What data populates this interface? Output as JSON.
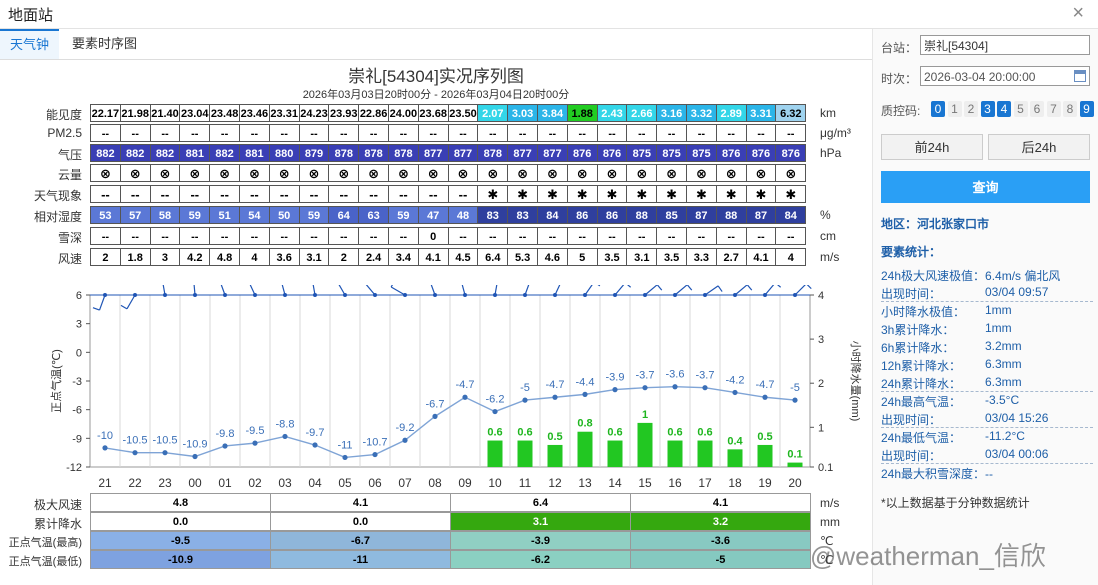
{
  "window": {
    "title": "地面站",
    "close": "×"
  },
  "tabs": [
    {
      "label": "天气钟"
    },
    {
      "label": "要素时序图"
    }
  ],
  "chart": {
    "title": "崇礼[54304]实况序列图",
    "subtitle": "2026年03月03日20时00分 - 2026年03月04日20时00分"
  },
  "table": {
    "rows": [
      {
        "label": "能见度",
        "unit": "km",
        "values": [
          "22.17",
          "21.98",
          "21.40",
          "23.04",
          "23.48",
          "23.46",
          "23.31",
          "24.23",
          "23.93",
          "22.86",
          "24.00",
          "23.68",
          "23.50",
          "2.07",
          "3.03",
          "3.84",
          "1.88",
          "2.43",
          "2.66",
          "3.16",
          "3.32",
          "2.89",
          "3.31",
          "6.32"
        ]
      },
      {
        "label": "PM2.5",
        "unit": "μg/m³",
        "values": [
          "--",
          "--",
          "--",
          "--",
          "--",
          "--",
          "--",
          "--",
          "--",
          "--",
          "--",
          "--",
          "--",
          "--",
          "--",
          "--",
          "--",
          "--",
          "--",
          "--",
          "--",
          "--",
          "--",
          "--"
        ]
      },
      {
        "label": "气压",
        "unit": "hPa",
        "values": [
          "882",
          "882",
          "882",
          "881",
          "882",
          "881",
          "880",
          "879",
          "878",
          "878",
          "878",
          "877",
          "877",
          "878",
          "877",
          "877",
          "876",
          "876",
          "875",
          "875",
          "875",
          "876",
          "876",
          "876"
        ]
      },
      {
        "label": "云量",
        "unit": "",
        "values": [
          "⊗",
          "⊗",
          "⊗",
          "⊗",
          "⊗",
          "⊗",
          "⊗",
          "⊗",
          "⊗",
          "⊗",
          "⊗",
          "⊗",
          "⊗",
          "⊗",
          "⊗",
          "⊗",
          "⊗",
          "⊗",
          "⊗",
          "⊗",
          "⊗",
          "⊗",
          "⊗",
          "⊗"
        ]
      },
      {
        "label": "天气现象",
        "unit": "",
        "values": [
          "--",
          "--",
          "--",
          "--",
          "--",
          "--",
          "--",
          "--",
          "--",
          "--",
          "--",
          "--",
          "--",
          "✱",
          "✱",
          "✱",
          "✱",
          "✱",
          "✱",
          "✱",
          "✱",
          "✱",
          "✱",
          "✱"
        ]
      },
      {
        "label": "相对湿度",
        "unit": "%",
        "values": [
          "53",
          "57",
          "58",
          "59",
          "51",
          "54",
          "50",
          "59",
          "64",
          "63",
          "59",
          "47",
          "48",
          "83",
          "83",
          "84",
          "86",
          "86",
          "88",
          "85",
          "87",
          "88",
          "87",
          "84"
        ]
      },
      {
        "label": "雪深",
        "unit": "cm",
        "values": [
          "--",
          "--",
          "--",
          "--",
          "--",
          "--",
          "--",
          "--",
          "--",
          "--",
          "--",
          "0",
          "--",
          "--",
          "--",
          "--",
          "--",
          "--",
          "--",
          "--",
          "--",
          "--",
          "--",
          "--"
        ]
      },
      {
        "label": "风速",
        "unit": "m/s",
        "values": [
          "2",
          "1.8",
          "3",
          "4.2",
          "4.8",
          "4",
          "3.6",
          "3.1",
          "2",
          "2.4",
          "3.4",
          "4.1",
          "4.5",
          "6.4",
          "5.3",
          "4.6",
          "5",
          "3.5",
          "3.1",
          "3.5",
          "3.3",
          "2.7",
          "4.1",
          "4"
        ]
      }
    ]
  },
  "chart_data": {
    "type": "line",
    "x": [
      "21",
      "22",
      "23",
      "00",
      "01",
      "02",
      "03",
      "04",
      "05",
      "06",
      "07",
      "08",
      "09",
      "10",
      "11",
      "12",
      "13",
      "14",
      "15",
      "16",
      "17",
      "18",
      "19",
      "20"
    ],
    "ylabel": "正点气温(℃)",
    "ylim": [
      -12,
      6
    ],
    "yticks": [
      6,
      3,
      0,
      -3,
      -6,
      -9,
      -12
    ],
    "y2label": "小时降水量(mm)",
    "y2lim": [
      0.1,
      4
    ],
    "y2ticks": [
      4,
      3,
      2,
      1,
      0.1
    ],
    "grid": true,
    "temperature": [
      -10,
      -10.5,
      -10.5,
      -10.9,
      -9.8,
      -9.5,
      -8.8,
      -9.7,
      -11,
      -10.7,
      -9.2,
      -6.7,
      -4.7,
      -6.2,
      -5,
      -4.7,
      -4.4,
      -3.9,
      -3.7,
      -3.6,
      -3.7,
      -4.2,
      -4.7,
      -5
    ],
    "temperature_labels": [
      "-10",
      "-10.5",
      "-10.5",
      "-10.9",
      "-9.8",
      "-9.5",
      "-8.8",
      "-9.7",
      "-11",
      "-10.7",
      "-9.2",
      "-6.7",
      "-4.7",
      "-6.2",
      "-5",
      "-4.7",
      "-4.4",
      "-3.9",
      "-3.7",
      "-3.6",
      "-3.7",
      "-4.2",
      "-4.7",
      "-5"
    ],
    "precipitation": [
      0,
      0,
      0,
      0,
      0,
      0,
      0,
      0,
      0,
      0,
      0,
      0,
      0,
      0.6,
      0.6,
      0.5,
      0.8,
      0.6,
      1,
      0.6,
      0.6,
      0.4,
      0.5,
      0.1
    ],
    "precipitation_labels": [
      "",
      "",
      "",
      "",
      "",
      "",
      "",
      "",
      "",
      "",
      "",
      "",
      "",
      "0.6",
      "0.6",
      "0.5",
      "0.8",
      "0.6",
      "1",
      "0.6",
      "0.6",
      "0.4",
      "0.5",
      "0.1"
    ],
    "colors": {
      "temperature": "#3a6fb7",
      "precipitation": "#22c722",
      "wind": "#1f55b5"
    }
  },
  "summary": {
    "rows": [
      {
        "label": "极大风速",
        "unit": "m/s",
        "values": [
          "4.8",
          "4.1",
          "6.4",
          "4.1"
        ]
      },
      {
        "label": "累计降水",
        "unit": "mm",
        "values": [
          "0.0",
          "0.0",
          "3.1",
          "3.2"
        ]
      },
      {
        "label": "正点气温(最高)",
        "unit": "℃",
        "values": [
          "-9.5",
          "-6.7",
          "-3.9",
          "-3.6"
        ]
      },
      {
        "label": "正点气温(最低)",
        "unit": "℃",
        "values": [
          "-10.9",
          "-11",
          "-6.2",
          "-5"
        ]
      }
    ]
  },
  "sidebar": {
    "station_label": "台站：",
    "station_value": "崇礼[54304]",
    "time_label": "时次：",
    "time_value": "2026-03-04 20:00:00",
    "qc_label": "质控码:",
    "qc_codes": [
      "0",
      "1",
      "2",
      "3",
      "4",
      "5",
      "6",
      "7",
      "8",
      "9"
    ],
    "qc_on": [
      true,
      false,
      false,
      true,
      true,
      false,
      false,
      false,
      false,
      true
    ],
    "prev_label": "前24h",
    "next_label": "后24h",
    "query_label": "查询",
    "region": "地区：河北张家口市",
    "stats_title": "要素统计：",
    "stats": [
      {
        "k": "24h极大风速极值：",
        "v": "6.4m/s 偏北风",
        "inline": true
      },
      {
        "k": "出现时间：",
        "v": "03/04 09:57"
      },
      {
        "k": "小时降水极值：",
        "v": "1mm"
      },
      {
        "k": "3h累计降水：",
        "v": "1mm"
      },
      {
        "k": "6h累计降水：",
        "v": "3.2mm"
      },
      {
        "k": "12h累计降水：",
        "v": "6.3mm"
      },
      {
        "k": "24h累计降水：",
        "v": "6.3mm"
      },
      {
        "k": "24h最高气温：",
        "v": "-3.5°C"
      },
      {
        "k": "出现时间：",
        "v": "03/04 15:26"
      },
      {
        "k": "24h最低气温：",
        "v": "-11.2°C"
      },
      {
        "k": "出现时间：",
        "v": "03/04 00:06"
      },
      {
        "k": "24h最大积雪深度：",
        "v": "--",
        "inline": true
      }
    ],
    "footnote": "*以上数据基于分钟数据统计"
  },
  "watermark": "@weatherman_信欣"
}
